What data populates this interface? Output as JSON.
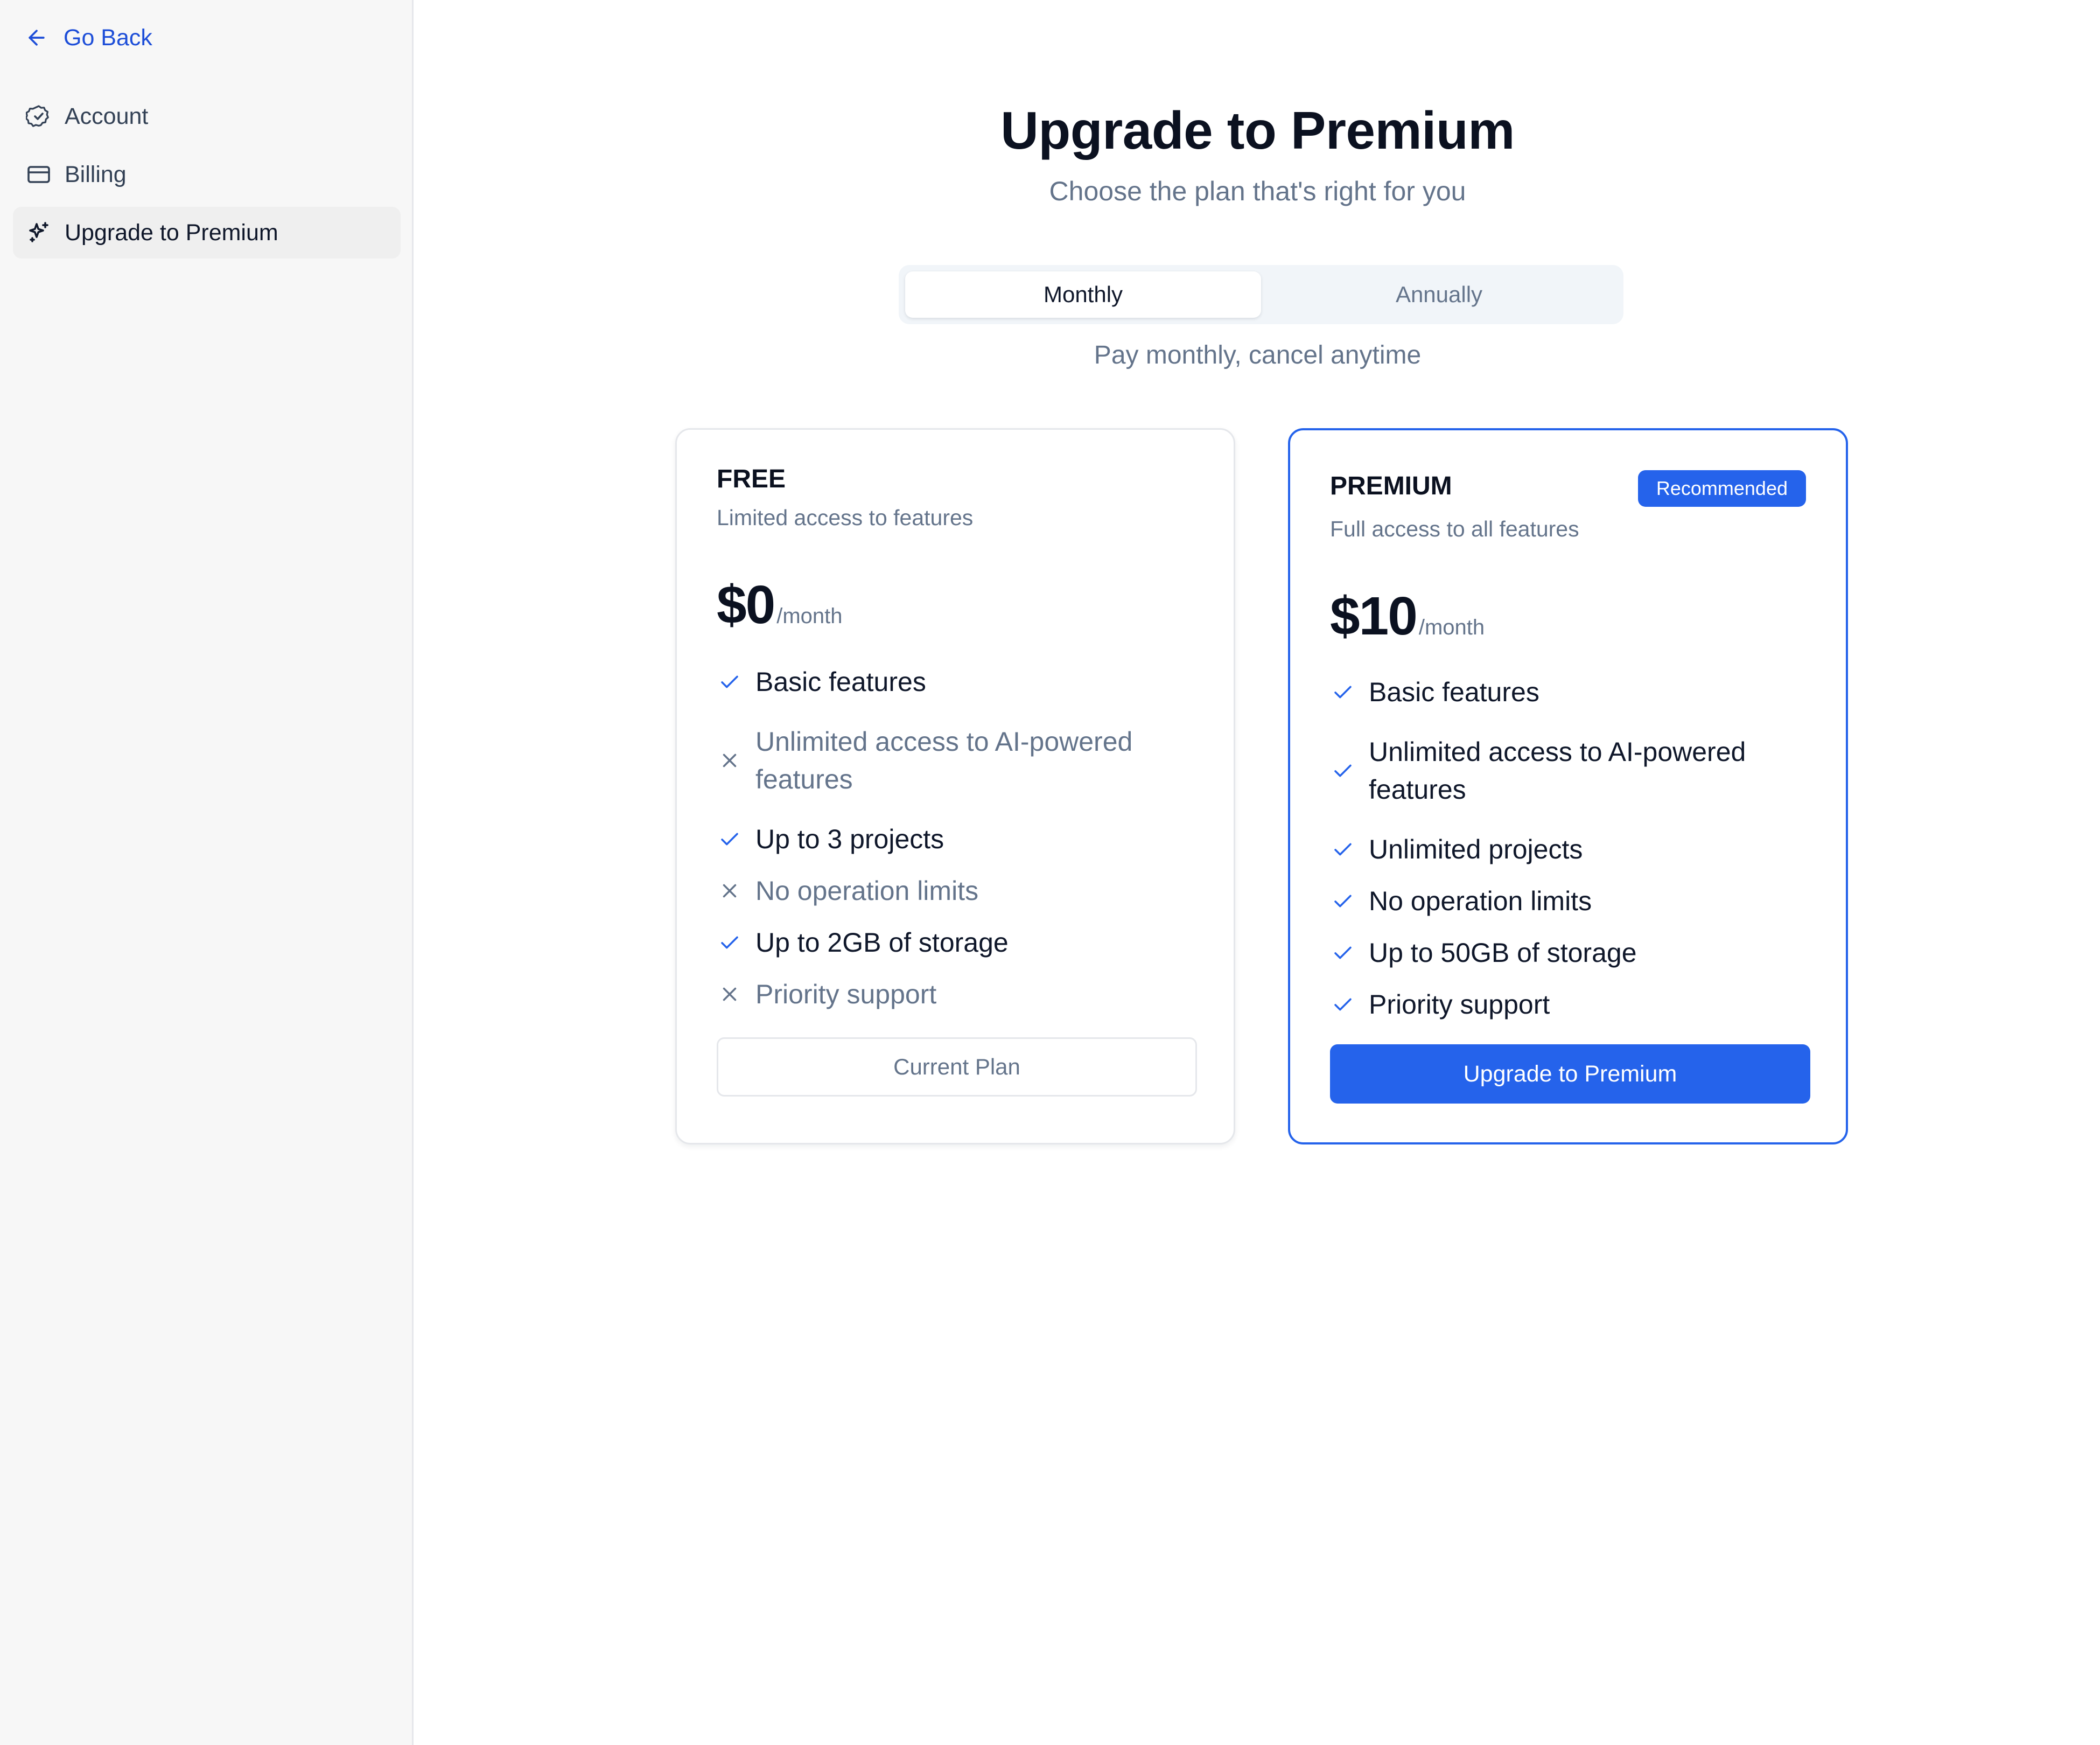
{
  "sidebar": {
    "go_back": "Go Back",
    "items": [
      {
        "label": "Account",
        "icon": "check-circle-icon"
      },
      {
        "label": "Billing",
        "icon": "credit-card-icon"
      },
      {
        "label": "Upgrade to Premium",
        "icon": "sparkles-icon",
        "active": true
      }
    ]
  },
  "header": {
    "title": "Upgrade to Premium",
    "subtitle": "Choose the plan that's right for you"
  },
  "billing_toggle": {
    "options": [
      "Monthly",
      "Annually"
    ],
    "selected": "Monthly",
    "note": "Pay monthly, cancel anytime"
  },
  "plans": [
    {
      "name": "FREE",
      "description": "Limited access to features",
      "price": "$0",
      "period": "/month",
      "features": [
        {
          "label": "Basic features",
          "included": true
        },
        {
          "label": "Unlimited access to AI-powered features",
          "included": false
        },
        {
          "label": "Up to 3 projects",
          "included": true
        },
        {
          "label": "No operation limits",
          "included": false
        },
        {
          "label": "Up to 2GB of storage",
          "included": true
        },
        {
          "label": "Priority support",
          "included": false
        }
      ],
      "button": "Current Plan"
    },
    {
      "name": "PREMIUM",
      "badge": "Recommended",
      "description": "Full access to all features",
      "price": "$10",
      "period": "/month",
      "features": [
        {
          "label": "Basic features",
          "included": true
        },
        {
          "label": "Unlimited access to AI-powered features",
          "included": true
        },
        {
          "label": "Unlimited projects",
          "included": true
        },
        {
          "label": "No operation limits",
          "included": true
        },
        {
          "label": "Up to 50GB of storage",
          "included": true
        },
        {
          "label": "Priority support",
          "included": true
        }
      ],
      "button": "Upgrade to Premium"
    }
  ],
  "colors": {
    "accent": "#2563eb",
    "link": "#1d4ed8",
    "muted_text": "#64748b",
    "sidebar_bg": "#f7f7f7"
  }
}
